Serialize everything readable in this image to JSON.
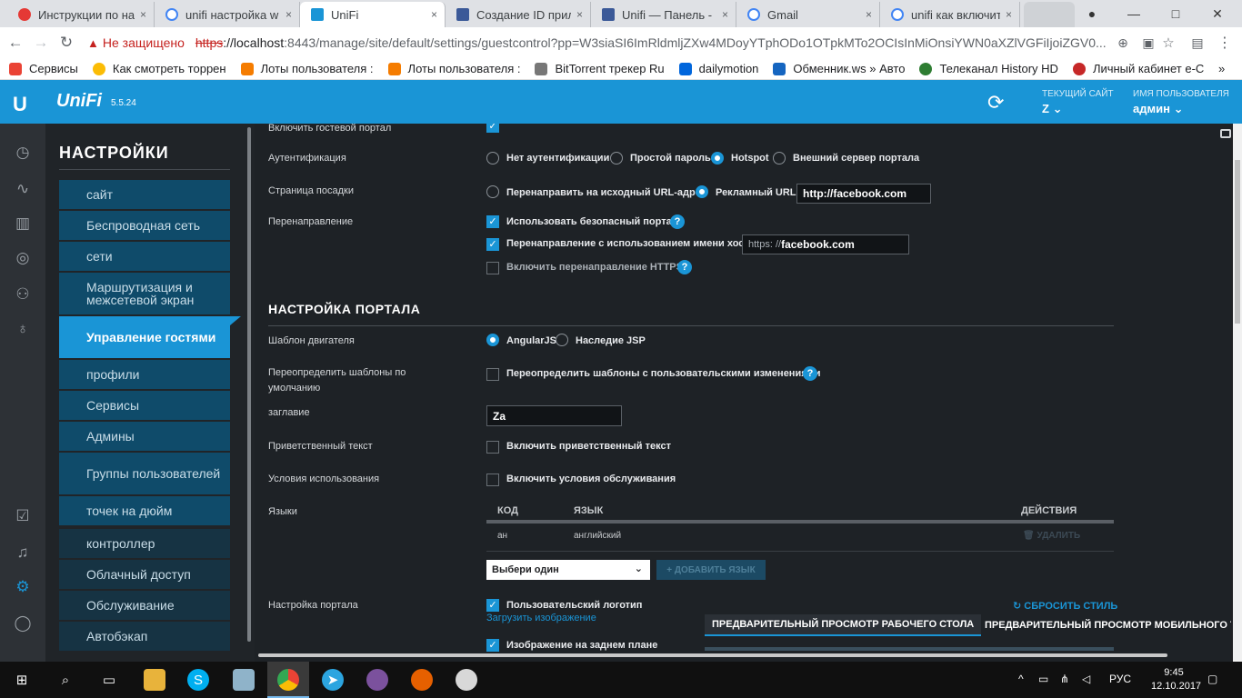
{
  "browser": {
    "tabs": [
      {
        "title": "Инструкции по на",
        "color": "#e53935",
        "active": false
      },
      {
        "title": "unifi настройка w",
        "color": "#4285f4",
        "active": false
      },
      {
        "title": "UniFi",
        "color": "#1a95d6",
        "active": true
      },
      {
        "title": "Создание ID прил",
        "color": "#3b5998",
        "active": false
      },
      {
        "title": "Unifi — Панель - ",
        "color": "#3b5998",
        "active": false
      },
      {
        "title": "Gmail",
        "color": "#4285f4",
        "active": false
      },
      {
        "title": "unifi как включит",
        "color": "#4285f4",
        "active": false
      }
    ],
    "tab_close": "×",
    "window_controls": {
      "profile": "●",
      "minimize": "—",
      "maximize": "□",
      "close": "✕"
    },
    "address": {
      "warning_label": "Не защищено",
      "scheme": "https",
      "host": "://localhost",
      "rest": ":8443/manage/site/default/settings/guestcontrol?pp=W3siaSI6ImRldmljZXw4MDoyYTphODo1OTpkMTo2OCIsInMiOnsiYWN0aXZlVGFiIjoiZGV0..."
    },
    "bookmarks": [
      {
        "label": "Сервисы",
        "color": "#ea4335"
      },
      {
        "label": "Как смотреть торрен",
        "color": "#fbbc05"
      },
      {
        "label": "Лоты пользователя :",
        "color": "#f57c00"
      },
      {
        "label": "Лоты пользователя :",
        "color": "#f57c00"
      },
      {
        "label": "BitTorrent трекер Ru",
        "color": "#777777"
      },
      {
        "label": "dailymotion",
        "color": "#0066dc"
      },
      {
        "label": "Обменник.ws » Авто",
        "color": "#1565c0"
      },
      {
        "label": "Телеканал History HD",
        "color": "#2e7d32"
      },
      {
        "label": "Личный кабинет е-С",
        "color": "#c62828"
      }
    ],
    "bookmarks_more": "»"
  },
  "header": {
    "product": "UniFi",
    "version": "5.5.24",
    "site_label": "ТЕКУЩИЙ САЙТ",
    "site_value": "Z",
    "user_label": "ИМЯ ПОЛЬЗОВАТЕЛЯ",
    "user_value": "админ"
  },
  "settings_menu": {
    "title": "НАСТРОЙКИ",
    "items": [
      "сайт",
      "Беспроводная сеть",
      "сети",
      "Маршрутизация и межсетевой экран",
      "Управление гостями",
      "профили",
      "Сервисы",
      "Админы",
      "Группы пользователей",
      "точек на дюйм",
      "контроллер",
      "Облачный доступ",
      "Обслуживание",
      "Автобэкап"
    ]
  },
  "form": {
    "enable_portal_label": "Включить гостевой портал",
    "auth_label": "Аутентификация",
    "auth_options": [
      "Нет аутентификации",
      "Простой пароль",
      "Hotspot",
      "Внешний сервер портала"
    ],
    "auth_selected": "Hotspot",
    "landing_label": "Страница посадки",
    "landing_options": [
      "Перенаправить на исходный URL-адрес",
      "Рекламный URL"
    ],
    "landing_selected": "Рекламный URL",
    "landing_url": "http://facebook.com",
    "redirect_label": "Перенаправление",
    "redirect_secure": "Использовать безопасный портал",
    "redirect_hostname": "Перенаправление с использованием имени хоста",
    "hostname_prefix": "https: //",
    "hostname_value": "facebook.com",
    "redirect_https": "Включить перенаправление HTTPS",
    "help_glyph": "?",
    "portal_section": "НАСТРОЙКА ПОРТАЛА",
    "engine_label": "Шаблон двигателя",
    "engine_options": [
      "AngularJS",
      "Наследие JSP"
    ],
    "engine_selected": "AngularJS",
    "override_label": "Переопределить шаблоны по умолчанию",
    "override_option": "Переопределить шаблоны с пользовательскими изменениями",
    "title_label": "заглавие",
    "title_value": "Za",
    "welcome_label": "Приветственный текст",
    "welcome_option": "Включить приветственный текст",
    "terms_label": "Условия использования",
    "terms_option": "Включить условия обслуживания",
    "languages_label": "Языки",
    "lang_table": {
      "headers": [
        "КОД",
        "ЯЗЫК",
        "ДЕЙСТВИЯ"
      ],
      "rows": [
        {
          "code": "ан",
          "language": "английский",
          "action": "УДАЛИТЬ"
        }
      ]
    },
    "lang_select": "Выбери один",
    "add_language": "+ ДОБАВИТЬ ЯЗЫК",
    "portal_custom_label": "Настройка портала",
    "custom_logo": "Пользовательский логотип",
    "upload_image": "Загрузить изображение",
    "background_image": "Изображение на заднем плане",
    "reset_style": "СБРОСИТЬ СТИЛЬ",
    "preview_desktop": "ПРЕДВАРИТЕЛЬНЫЙ ПРОСМОТР РАБОЧЕГО СТОЛА",
    "preview_mobile": "ПРЕДВАРИТЕЛЬНЫЙ ПРОСМОТР МОБИЛЬНОГО Т"
  },
  "taskbar": {
    "language": "РУС",
    "time": "9:45",
    "date": "12.10.2017"
  },
  "colors": {
    "accent": "#1a95d6",
    "menu_item": "#0f4b6a",
    "content_bg": "#1e2226"
  }
}
